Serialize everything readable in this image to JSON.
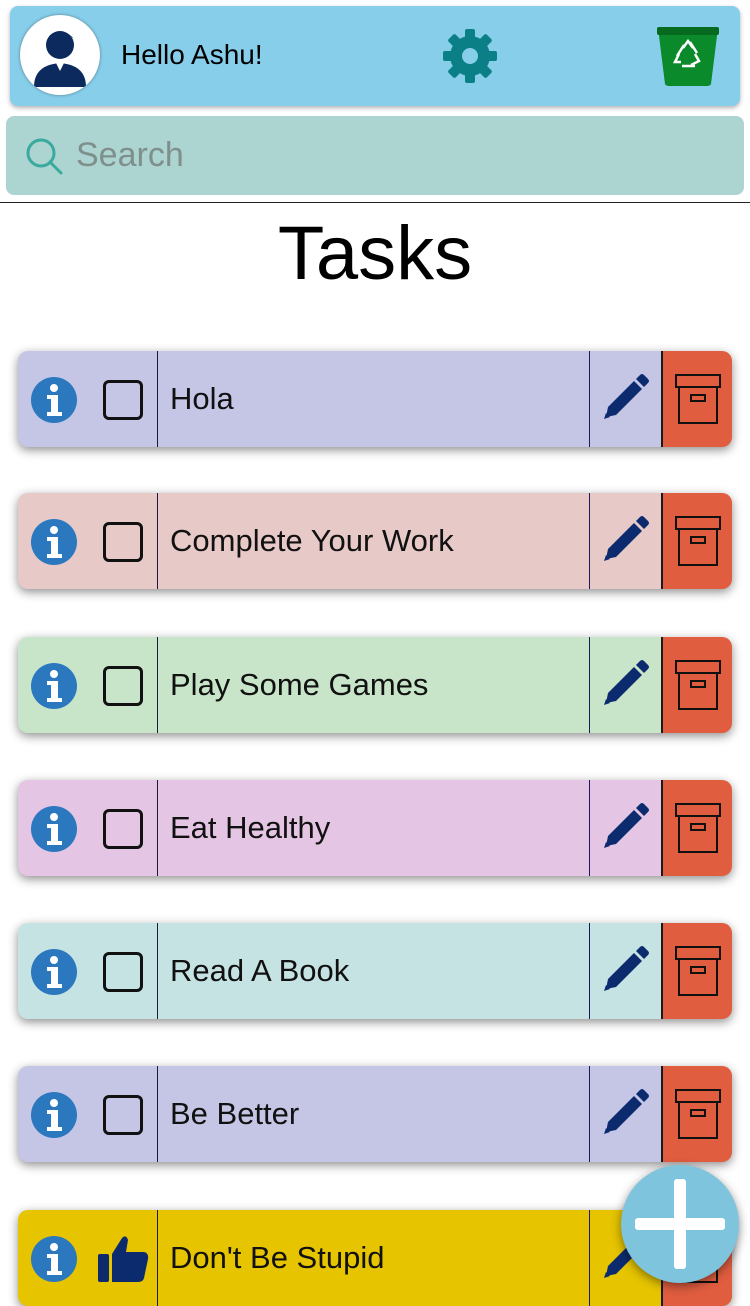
{
  "header": {
    "greeting": "Hello Ashu!",
    "avatar_icon": "user-avatar-icon",
    "settings_icon": "gear-icon",
    "bin_icon": "recycle-bin-icon",
    "background_color": "#87ceea"
  },
  "search": {
    "placeholder": "Search",
    "value": ""
  },
  "title": "Tasks",
  "tasks": [
    {
      "label": "Hola",
      "completed": false,
      "color": "#c5c6e6"
    },
    {
      "label": "Complete Your Work",
      "completed": false,
      "color": "#e7c9c8"
    },
    {
      "label": "Play Some Games",
      "completed": false,
      "color": "#c8e5c9"
    },
    {
      "label": "Eat Healthy",
      "completed": false,
      "color": "#e4c5e3"
    },
    {
      "label": "Read A Book",
      "completed": false,
      "color": "#c6e3e3"
    },
    {
      "label": "Be Better",
      "completed": false,
      "color": "#c5c6e6"
    },
    {
      "label": "Don't Be Stupid",
      "completed": true,
      "color": "#e6c400"
    }
  ],
  "colors": {
    "archive": "#e05d3f",
    "info": "#2b78bf",
    "edit": "#0c2a6e",
    "fab": "#7fc4dd"
  }
}
